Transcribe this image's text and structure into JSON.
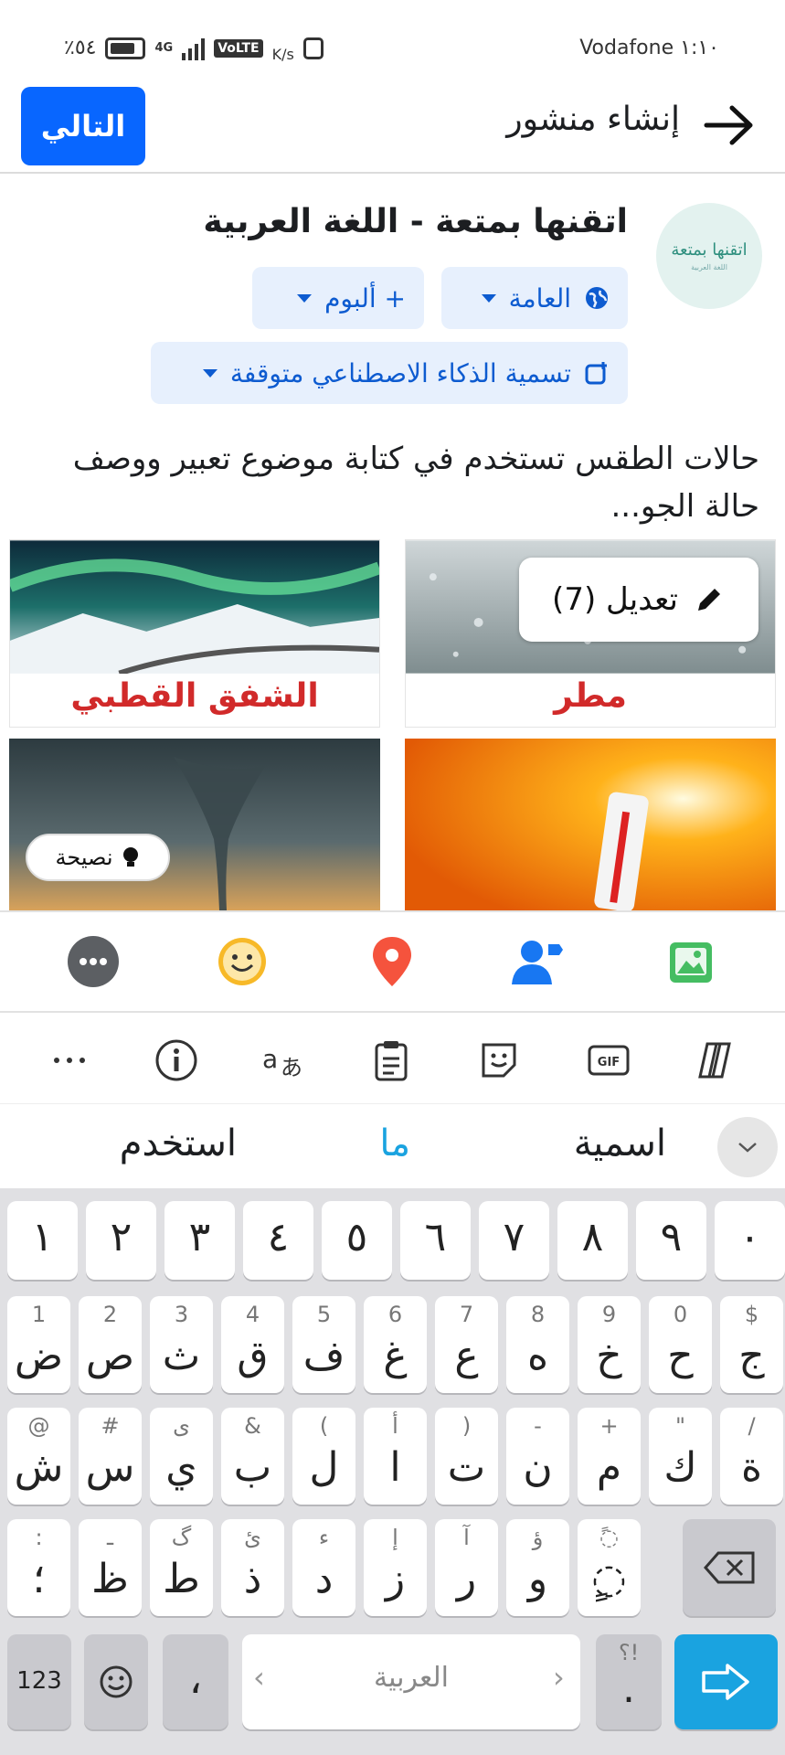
{
  "status_bar": {
    "battery_text": "٪٥٤",
    "network": "4G",
    "volte": "VoLTE",
    "speed": "K/s",
    "time_carrier": "١:١٠ Vodafone"
  },
  "header": {
    "title": "إنشاء منشور",
    "next_label": "التالي"
  },
  "profile": {
    "name": "اتقنها بمتعة - اللغة  العربية",
    "avatar_text": "اتقنها بمتعة",
    "avatar_subtext": "اللغة العربية"
  },
  "controls": {
    "audience_label": "العامة",
    "album_label": "+ ألبوم",
    "ai_label": "تسمية الذكاء الاصطناعي متوقفة"
  },
  "post": {
    "text": "حالات الطقس تستخدم في كتابة موضوع تعبير ووصف حالة الجو..."
  },
  "images": {
    "rain_caption": "مطر",
    "aurora_caption": "الشفق القطبي",
    "edit_label": "تعديل (7)",
    "tip_label": "نصيحة"
  },
  "keyboard": {
    "suggestions": [
      "اسمية",
      "ما",
      "استخدم"
    ],
    "numbers": [
      "١",
      "٢",
      "٣",
      "٤",
      "٥",
      "٦",
      "٧",
      "٨",
      "٩",
      "٠"
    ],
    "row1": [
      {
        "main": "ض",
        "hint": "1"
      },
      {
        "main": "ص",
        "hint": "2"
      },
      {
        "main": "ث",
        "hint": "3"
      },
      {
        "main": "ق",
        "hint": "4"
      },
      {
        "main": "ف",
        "hint": "5"
      },
      {
        "main": "غ",
        "hint": "6"
      },
      {
        "main": "ع",
        "hint": "7"
      },
      {
        "main": "ه",
        "hint": "8"
      },
      {
        "main": "خ",
        "hint": "9"
      },
      {
        "main": "ح",
        "hint": "0"
      },
      {
        "main": "ج",
        "hint": "$"
      }
    ],
    "row2": [
      {
        "main": "ش",
        "hint": "@"
      },
      {
        "main": "س",
        "hint": "#"
      },
      {
        "main": "ي",
        "hint": "ى"
      },
      {
        "main": "ب",
        "hint": "&"
      },
      {
        "main": "ل",
        "hint": "("
      },
      {
        "main": "ا",
        "hint": "أ"
      },
      {
        "main": "ت",
        "hint": ")"
      },
      {
        "main": "ن",
        "hint": "-"
      },
      {
        "main": "م",
        "hint": "+"
      },
      {
        "main": "ك",
        "hint": "\""
      },
      {
        "main": "ة",
        "hint": "/"
      }
    ],
    "row3": [
      {
        "main": "؛",
        "hint": ":"
      },
      {
        "main": "ظ",
        "hint": "ـ"
      },
      {
        "main": "ط",
        "hint": "گ"
      },
      {
        "main": "ذ",
        "hint": "ئ"
      },
      {
        "main": "د",
        "hint": "ء"
      },
      {
        "main": "ز",
        "hint": "إ"
      },
      {
        "main": "ر",
        "hint": "آ"
      },
      {
        "main": "و",
        "hint": "ؤ"
      },
      {
        "main": "◌ٍ",
        "hint": "◌ً"
      }
    ],
    "mode_label": "123",
    "comma_label": "،",
    "space_label": "العربية",
    "punct_hint": "؟!",
    "punct_main": "."
  },
  "colors": {
    "accent": "#0866ff",
    "pill_bg": "#e7f0fd",
    "caption_red": "#d12a2a",
    "enter_key": "#1aa3e0"
  }
}
